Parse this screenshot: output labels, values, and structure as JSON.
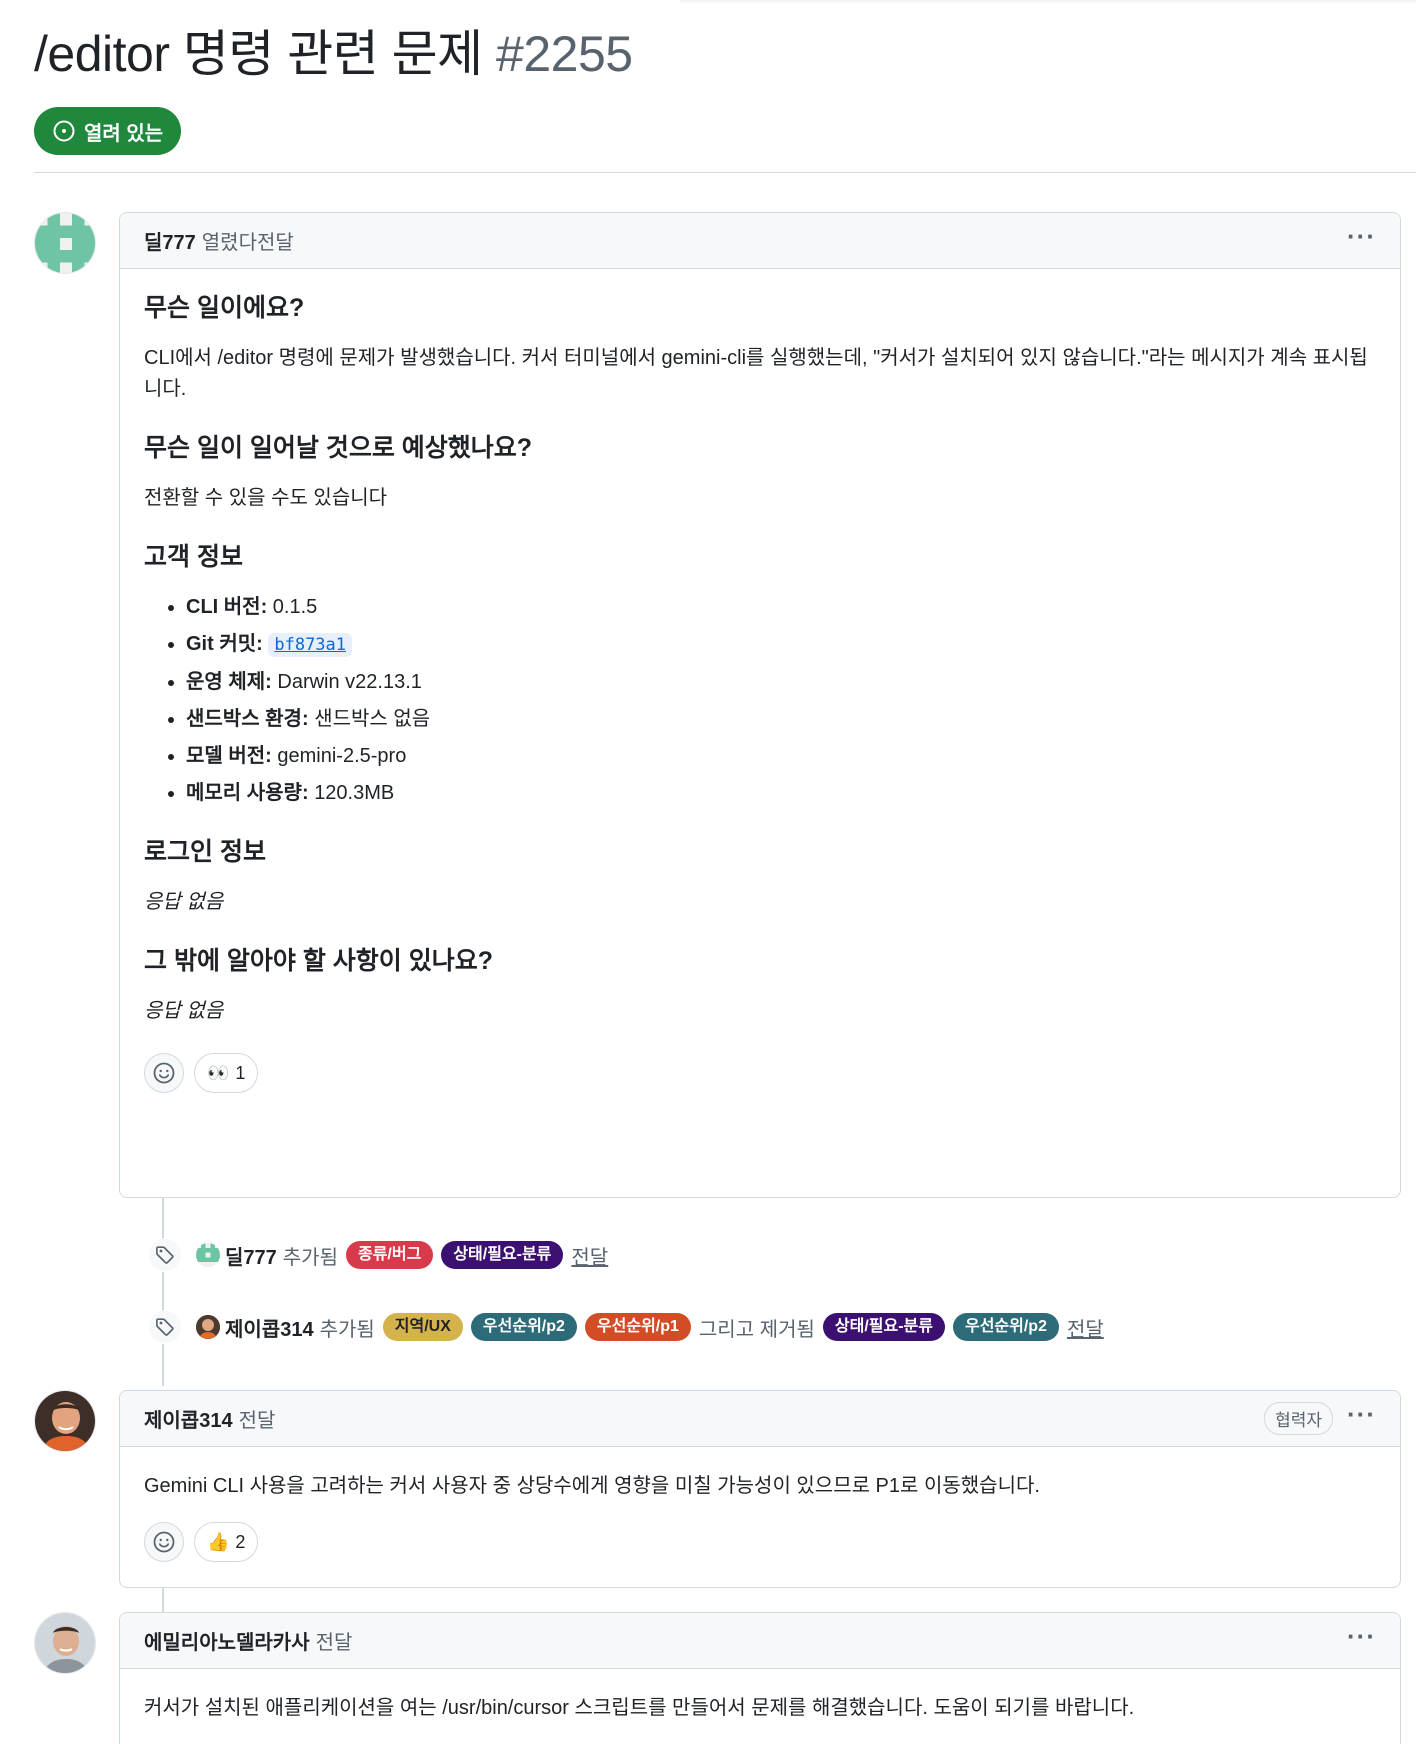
{
  "issue": {
    "title": "/editor 명령 관련 문제",
    "number": "#2255",
    "state": "열려 있는"
  },
  "comment1": {
    "author": "딜777",
    "action": "열렸다전달",
    "heading1": "무슨 일이에요?",
    "para1": "CLI에서 /editor 명령에 문제가 발생했습니다. 커서 터미널에서 gemini-cli를 실행했는데, \"커서가 설치되어 있지 않습니다.\"라는 메시지가 계속 표시됩니다.",
    "heading2": "무슨 일이 일어날 것으로 예상했나요?",
    "para2": "전환할 수 있을 수도 있습니다",
    "heading3": "고객 정보",
    "info": [
      {
        "key": "CLI 버전:",
        "value": "0.1.5"
      },
      {
        "key": "Git 커밋:",
        "value": "bf873a1"
      },
      {
        "key": "운영 체제:",
        "value": "Darwin v22.13.1"
      },
      {
        "key": "샌드박스 환경:",
        "value": "샌드박스 없음"
      },
      {
        "key": "모델 버전:",
        "value": "gemini-2.5-pro"
      },
      {
        "key": "메모리 사용량:",
        "value": "120.3MB"
      }
    ],
    "heading4": "로그인 정보",
    "para4": "응답 없음",
    "heading5": "그 밖에 알아야 할 사항이 있나요?",
    "para5": "응답 없음",
    "reaction_emoji": "👀",
    "reaction_count": "1"
  },
  "event1": {
    "who": "딜777",
    "verb": "추가됨",
    "labels": [
      {
        "text": "종류/버그",
        "color": "#d73a4a"
      },
      {
        "text": "상태/필요-분류",
        "color": "#3b1070"
      }
    ],
    "link": "전달"
  },
  "event2": {
    "who": "제이콥314",
    "verb": "추가됨",
    "added": [
      {
        "text": "지역/UX",
        "color": "#d4b24c",
        "textColor": "#1f2328"
      },
      {
        "text": "우선순위/p2",
        "color": "#2e6b78",
        "textColor": "#ffffff"
      },
      {
        "text": "우선순위/p1",
        "color": "#d24d26",
        "textColor": "#ffffff"
      }
    ],
    "and_removed": "그리고 제거됨",
    "removed": [
      {
        "text": "상태/필요-분류",
        "color": "#3b1070",
        "textColor": "#ffffff"
      },
      {
        "text": "우선순위/p2",
        "color": "#2e6b78",
        "textColor": "#ffffff"
      }
    ],
    "link": "전달"
  },
  "comment2": {
    "author": "제이콥314",
    "action": "전달",
    "role": "협력자",
    "body": "Gemini CLI 사용을 고려하는 커서 사용자 중 상당수에게 영향을 미칠 가능성이 있으므로 P1로 이동했습니다.",
    "reaction_emoji": "👍",
    "reaction_count": "2"
  },
  "comment3": {
    "author": "에밀리아노델라카사",
    "action": "전달",
    "body": "커서가 설치된 애플리케이션을 여는 /usr/bin/cursor 스크립트를 만들어서 문제를 해결했습니다. 도움이 되기를 바랍니다."
  },
  "icons": {
    "kebab": "···",
    "state": "issue-opened-icon",
    "tag": "tag-icon",
    "smiley": "smiley-icon"
  },
  "colors": {
    "open": "#1f883d",
    "link": "#0969da",
    "muted": "#59636e",
    "border": "#d1d9e0"
  }
}
